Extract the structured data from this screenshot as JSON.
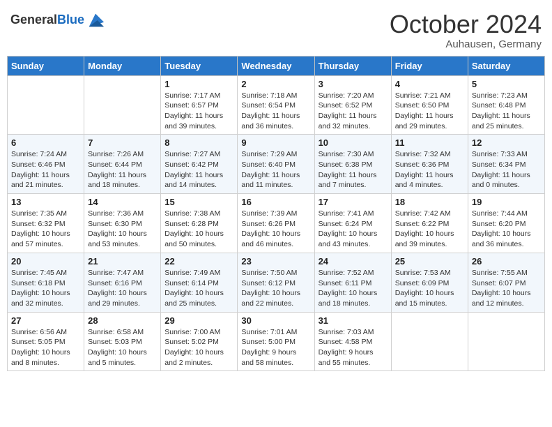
{
  "header": {
    "logo_general": "General",
    "logo_blue": "Blue",
    "month_title": "October 2024",
    "subtitle": "Auhausen, Germany"
  },
  "days_of_week": [
    "Sunday",
    "Monday",
    "Tuesday",
    "Wednesday",
    "Thursday",
    "Friday",
    "Saturday"
  ],
  "weeks": [
    [
      {
        "day": "",
        "sunrise": "",
        "sunset": "",
        "daylight": ""
      },
      {
        "day": "",
        "sunrise": "",
        "sunset": "",
        "daylight": ""
      },
      {
        "day": "1",
        "sunrise": "Sunrise: 7:17 AM",
        "sunset": "Sunset: 6:57 PM",
        "daylight": "Daylight: 11 hours and 39 minutes."
      },
      {
        "day": "2",
        "sunrise": "Sunrise: 7:18 AM",
        "sunset": "Sunset: 6:54 PM",
        "daylight": "Daylight: 11 hours and 36 minutes."
      },
      {
        "day": "3",
        "sunrise": "Sunrise: 7:20 AM",
        "sunset": "Sunset: 6:52 PM",
        "daylight": "Daylight: 11 hours and 32 minutes."
      },
      {
        "day": "4",
        "sunrise": "Sunrise: 7:21 AM",
        "sunset": "Sunset: 6:50 PM",
        "daylight": "Daylight: 11 hours and 29 minutes."
      },
      {
        "day": "5",
        "sunrise": "Sunrise: 7:23 AM",
        "sunset": "Sunset: 6:48 PM",
        "daylight": "Daylight: 11 hours and 25 minutes."
      }
    ],
    [
      {
        "day": "6",
        "sunrise": "Sunrise: 7:24 AM",
        "sunset": "Sunset: 6:46 PM",
        "daylight": "Daylight: 11 hours and 21 minutes."
      },
      {
        "day": "7",
        "sunrise": "Sunrise: 7:26 AM",
        "sunset": "Sunset: 6:44 PM",
        "daylight": "Daylight: 11 hours and 18 minutes."
      },
      {
        "day": "8",
        "sunrise": "Sunrise: 7:27 AM",
        "sunset": "Sunset: 6:42 PM",
        "daylight": "Daylight: 11 hours and 14 minutes."
      },
      {
        "day": "9",
        "sunrise": "Sunrise: 7:29 AM",
        "sunset": "Sunset: 6:40 PM",
        "daylight": "Daylight: 11 hours and 11 minutes."
      },
      {
        "day": "10",
        "sunrise": "Sunrise: 7:30 AM",
        "sunset": "Sunset: 6:38 PM",
        "daylight": "Daylight: 11 hours and 7 minutes."
      },
      {
        "day": "11",
        "sunrise": "Sunrise: 7:32 AM",
        "sunset": "Sunset: 6:36 PM",
        "daylight": "Daylight: 11 hours and 4 minutes."
      },
      {
        "day": "12",
        "sunrise": "Sunrise: 7:33 AM",
        "sunset": "Sunset: 6:34 PM",
        "daylight": "Daylight: 11 hours and 0 minutes."
      }
    ],
    [
      {
        "day": "13",
        "sunrise": "Sunrise: 7:35 AM",
        "sunset": "Sunset: 6:32 PM",
        "daylight": "Daylight: 10 hours and 57 minutes."
      },
      {
        "day": "14",
        "sunrise": "Sunrise: 7:36 AM",
        "sunset": "Sunset: 6:30 PM",
        "daylight": "Daylight: 10 hours and 53 minutes."
      },
      {
        "day": "15",
        "sunrise": "Sunrise: 7:38 AM",
        "sunset": "Sunset: 6:28 PM",
        "daylight": "Daylight: 10 hours and 50 minutes."
      },
      {
        "day": "16",
        "sunrise": "Sunrise: 7:39 AM",
        "sunset": "Sunset: 6:26 PM",
        "daylight": "Daylight: 10 hours and 46 minutes."
      },
      {
        "day": "17",
        "sunrise": "Sunrise: 7:41 AM",
        "sunset": "Sunset: 6:24 PM",
        "daylight": "Daylight: 10 hours and 43 minutes."
      },
      {
        "day": "18",
        "sunrise": "Sunrise: 7:42 AM",
        "sunset": "Sunset: 6:22 PM",
        "daylight": "Daylight: 10 hours and 39 minutes."
      },
      {
        "day": "19",
        "sunrise": "Sunrise: 7:44 AM",
        "sunset": "Sunset: 6:20 PM",
        "daylight": "Daylight: 10 hours and 36 minutes."
      }
    ],
    [
      {
        "day": "20",
        "sunrise": "Sunrise: 7:45 AM",
        "sunset": "Sunset: 6:18 PM",
        "daylight": "Daylight: 10 hours and 32 minutes."
      },
      {
        "day": "21",
        "sunrise": "Sunrise: 7:47 AM",
        "sunset": "Sunset: 6:16 PM",
        "daylight": "Daylight: 10 hours and 29 minutes."
      },
      {
        "day": "22",
        "sunrise": "Sunrise: 7:49 AM",
        "sunset": "Sunset: 6:14 PM",
        "daylight": "Daylight: 10 hours and 25 minutes."
      },
      {
        "day": "23",
        "sunrise": "Sunrise: 7:50 AM",
        "sunset": "Sunset: 6:12 PM",
        "daylight": "Daylight: 10 hours and 22 minutes."
      },
      {
        "day": "24",
        "sunrise": "Sunrise: 7:52 AM",
        "sunset": "Sunset: 6:11 PM",
        "daylight": "Daylight: 10 hours and 18 minutes."
      },
      {
        "day": "25",
        "sunrise": "Sunrise: 7:53 AM",
        "sunset": "Sunset: 6:09 PM",
        "daylight": "Daylight: 10 hours and 15 minutes."
      },
      {
        "day": "26",
        "sunrise": "Sunrise: 7:55 AM",
        "sunset": "Sunset: 6:07 PM",
        "daylight": "Daylight: 10 hours and 12 minutes."
      }
    ],
    [
      {
        "day": "27",
        "sunrise": "Sunrise: 6:56 AM",
        "sunset": "Sunset: 5:05 PM",
        "daylight": "Daylight: 10 hours and 8 minutes."
      },
      {
        "day": "28",
        "sunrise": "Sunrise: 6:58 AM",
        "sunset": "Sunset: 5:03 PM",
        "daylight": "Daylight: 10 hours and 5 minutes."
      },
      {
        "day": "29",
        "sunrise": "Sunrise: 7:00 AM",
        "sunset": "Sunset: 5:02 PM",
        "daylight": "Daylight: 10 hours and 2 minutes."
      },
      {
        "day": "30",
        "sunrise": "Sunrise: 7:01 AM",
        "sunset": "Sunset: 5:00 PM",
        "daylight": "Daylight: 9 hours and 58 minutes."
      },
      {
        "day": "31",
        "sunrise": "Sunrise: 7:03 AM",
        "sunset": "Sunset: 4:58 PM",
        "daylight": "Daylight: 9 hours and 55 minutes."
      },
      {
        "day": "",
        "sunrise": "",
        "sunset": "",
        "daylight": ""
      },
      {
        "day": "",
        "sunrise": "",
        "sunset": "",
        "daylight": ""
      }
    ]
  ]
}
